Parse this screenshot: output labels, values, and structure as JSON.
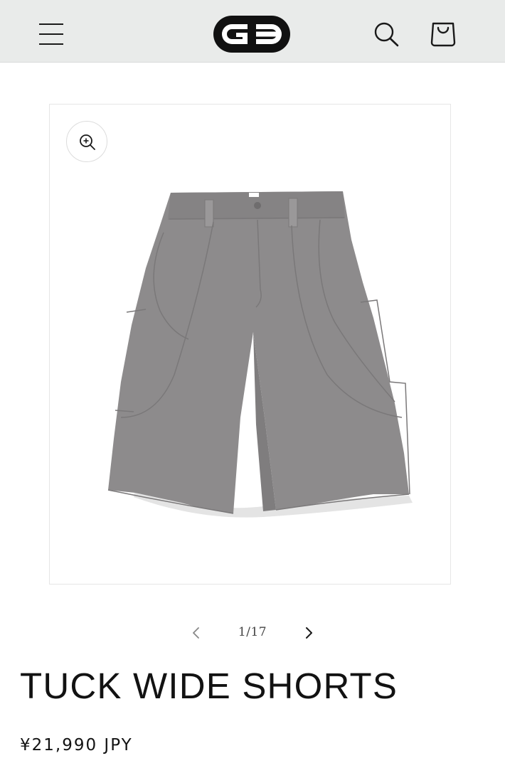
{
  "header": {
    "menu_icon": "hamburger-menu-icon",
    "logo_icon": "brand-logo",
    "search_icon": "search-icon",
    "cart_icon": "shopping-bag-icon",
    "background": "#e9ebea"
  },
  "gallery": {
    "zoom_icon": "zoom-in-icon",
    "image_subject": "gray wide shorts",
    "counter": "1/17",
    "prev_icon": "chevron-left-icon",
    "next_icon": "chevron-right-icon"
  },
  "product": {
    "title": "TUCK WIDE SHORTS",
    "price": "¥21,990 JPY"
  },
  "colors": {
    "garment": "#8d8b8c",
    "text": "#121212"
  }
}
